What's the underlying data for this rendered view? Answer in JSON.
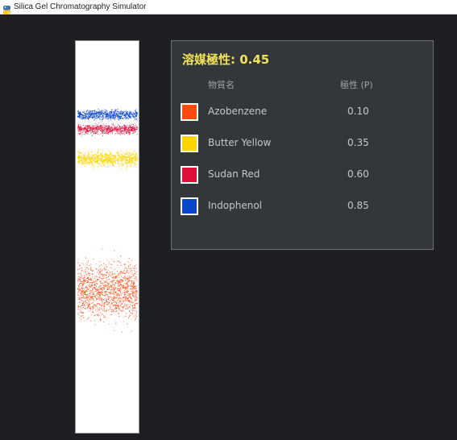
{
  "window": {
    "title": "Silica Gel Chromatography Simulator",
    "icon": "python-icon"
  },
  "panel": {
    "solvent_label": "溶媒極性: 0.45",
    "header_name": "物質名",
    "header_polarity": "極性 (P)",
    "substances": [
      {
        "name": "Azobenzene",
        "polarity": "0.10",
        "color": "#ff4a0f"
      },
      {
        "name": "Butter Yellow",
        "polarity": "0.35",
        "color": "#ffd400"
      },
      {
        "name": "Sudan Red",
        "polarity": "0.60",
        "color": "#e0103c"
      },
      {
        "name": "Indophenol",
        "polarity": "0.85",
        "color": "#0a46c8"
      }
    ]
  },
  "colors": {
    "background": "#1e1f22",
    "panel_bg": "#33373a",
    "accent_title": "#f2e15a"
  }
}
